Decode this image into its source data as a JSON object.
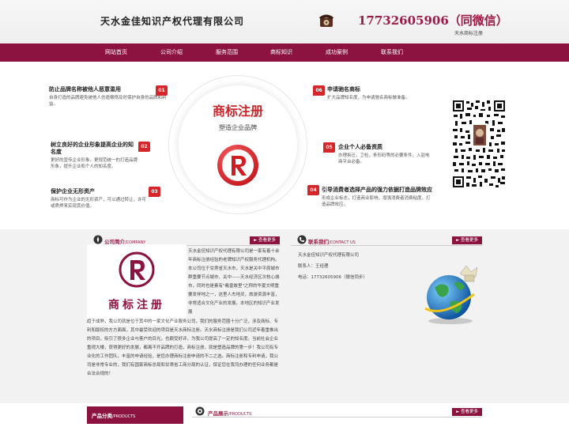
{
  "header": {
    "site_title": "天水金佳知识产权代理有限公司",
    "phone": "17732605906（同微信）",
    "phone_sub": "天水商标注册"
  },
  "nav": {
    "items": [
      {
        "label": "网站首页"
      },
      {
        "label": "公司介绍"
      },
      {
        "label": "服务范围"
      },
      {
        "label": "商标知识"
      },
      {
        "label": "成功案例"
      },
      {
        "label": "联系我们"
      }
    ]
  },
  "hero": {
    "title": "商标注册",
    "subtitle": "塑造企业品牌",
    "features": [
      {
        "num": "01",
        "title": "防止品牌名称被他人恶意滥用",
        "desc": "自身打造的品牌避免被他人仿造懒惰及时保护自身的品牌和利益。"
      },
      {
        "num": "02",
        "title": "树立良好的企业形象提高企业的知名度",
        "desc": "更好的宣传企业形象，更规范统一的打造品牌形象，提升企业和个人的知名度。"
      },
      {
        "num": "03",
        "title": "保护企业无形资产",
        "desc": "商标可作为企业的无形资产，可以通过转让，许可或质押来实现其价值。"
      },
      {
        "num": "06",
        "title": "申请驰名商标",
        "desc": "扩大品牌知名度，为申请驰名商标做准备。"
      },
      {
        "num": "05",
        "title": "企业个人必备资质",
        "desc": "办理拆迁，卫检，条形码等的必要条件，入驻电商平台必备。"
      },
      {
        "num": "04",
        "title": "引导消费者选择产品的强力依据打造品牌效应",
        "desc": "形成企业标志，打造商业影响，增强消费者消费粘度，打造品牌效应。"
      }
    ]
  },
  "about": {
    "title": "公司简介",
    "title_en": "/COMPANY",
    "more": "查看更多",
    "image_label": "商标注册",
    "text_right": "天水金佳知识产权代理有限公司是一家有着十余年商标注册经验的老牌知识产权服务代理机构。本公司位于甘肃省天水市，天水是关中平原城市群重要节点城市、关中——天水经济区次核心城市，同时也是素有\"羲皇故里\"之称的华夏文明重要发祥地之一，这里人杰地灵，旅游资源丰富，非常适合文化产业的发展。本地区的知识产业发展",
    "text_bottom": "趋于成熟，我公司就是位于其中的一家文化产业服务公司，我们的服务范围十分广泛，涉及商标、专利和版权的方方面面，其中最受欢迎的项目是天水商标注册。天水商标注册是我们公司近年着重推出的项目，吸引了很多企业与客户的目光，也颇受好评，为我公司提高了一定的知名度。当前社会企业重视大楼，获得更好的发展，都离不开品牌的打造，商标注册，就是塑造品牌的第一步！我公司有专业化的工作团队，丰富的申请经验，是您办理商标注册申请的不二之选。商标注册和专利申请，我公司是非常专业的，我们有国家商标总局和甘肃省工商分局的认证，保证您在我司办理的任何业务都是合法合规的！"
  },
  "contact": {
    "title": "联系我们",
    "title_en": "/CONTACT US",
    "more": "查看更多",
    "company": "天水金佳知识产权代理有限公司",
    "person": "联系人：王经理",
    "phone": "电话：17732605906（微信同步）"
  },
  "products": {
    "category_title": "产品分类",
    "category_en": "/PRODUCTS",
    "show_title": "产品展示",
    "show_en": "/PRODUCTS",
    "more": "查看更多"
  },
  "colors": {
    "brand": "#8c1340",
    "accent_red": "#d7262a",
    "title_red": "#c8262a"
  }
}
